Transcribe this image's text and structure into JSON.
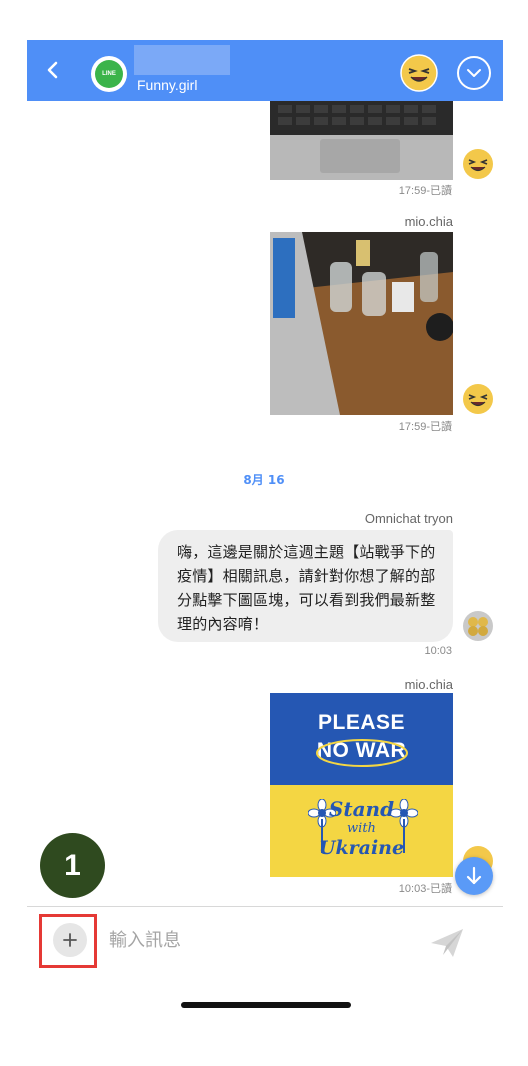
{
  "header": {
    "contact_name": "Funny.girl",
    "line_logo_text": "LINE"
  },
  "messages": [
    {
      "type": "photo",
      "status": "17:59-已讀"
    },
    {
      "type": "photo",
      "sender": "mio.chia",
      "status": "17:59-已讀"
    },
    {
      "type": "date",
      "label": "8月 16"
    },
    {
      "type": "text",
      "sender": "Omnichat tryon",
      "text": "嗨，這邊是關於這週主題【站戰爭下的疫情】相關訊息，請針對你想了解的部分點擊下圖區塊，可以看到我們最新整理的內容唷！",
      "status": "10:03"
    },
    {
      "type": "image_card",
      "sender": "mio.chia",
      "card_top": [
        "PLEASE",
        "NO WAR"
      ],
      "card_bottom": [
        "Stand",
        "with",
        "Ukraine"
      ],
      "status": "10:03-已讀"
    }
  ],
  "annotation": {
    "step_number": "1"
  },
  "composer": {
    "placeholder": "輸入訊息"
  },
  "colors": {
    "header_bg": "#4f8ff7",
    "line_green": "#3bb44a",
    "bubble_bg": "#eeeeee",
    "ukraine_blue": "#2557b3",
    "ukraine_yellow": "#f4d643",
    "highlight_red": "#e53935",
    "step_badge_bg": "#2f4a1f"
  },
  "icons": {
    "back": "chevron-left-icon",
    "menu": "chevron-down-circle-icon",
    "scroll": "arrow-down-icon",
    "add": "plus-icon",
    "send": "send-icon"
  }
}
